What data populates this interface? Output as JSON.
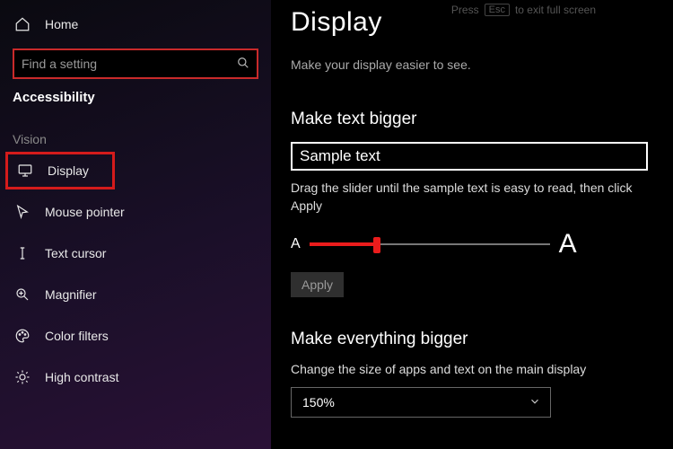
{
  "hint": {
    "press": "Press",
    "key": "Esc",
    "rest": "to exit full screen"
  },
  "sidebar": {
    "home": "Home",
    "search_placeholder": "Find a setting",
    "category": "Accessibility",
    "group_vision": "Vision",
    "items": [
      {
        "label": "Display"
      },
      {
        "label": "Mouse pointer"
      },
      {
        "label": "Text cursor"
      },
      {
        "label": "Magnifier"
      },
      {
        "label": "Color filters"
      },
      {
        "label": "High contrast"
      }
    ]
  },
  "main": {
    "title": "Display",
    "subtitle": "Make your display easier to see.",
    "section1": {
      "heading": "Make text bigger",
      "sample": "Sample text",
      "instruction": "Drag the slider until the sample text is easy to read, then click Apply",
      "small_a": "A",
      "big_a": "A",
      "apply": "Apply"
    },
    "section2": {
      "heading": "Make everything bigger",
      "desc": "Change the size of apps and text on the main display",
      "value": "150%"
    }
  }
}
